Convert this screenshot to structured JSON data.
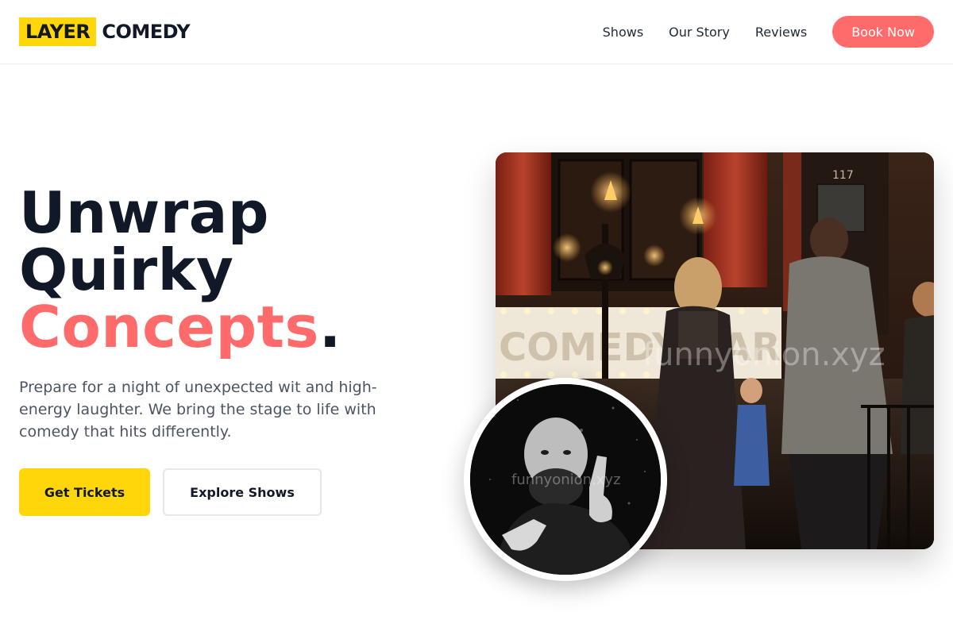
{
  "brand": {
    "highlight": "LAYER",
    "name": "COMEDY",
    "accent_color": "#ffd60a",
    "coral_color": "#ff6b6b"
  },
  "nav": {
    "links": [
      "Shows",
      "Our Story",
      "Reviews"
    ],
    "cta": "Book Now"
  },
  "hero": {
    "headline_line1": "Unwrap",
    "headline_line2": "Quirky",
    "headline_accent": "Concepts",
    "headline_period": ".",
    "subtext": "Prepare for a night of unexpected wit and high-energy laughter. We bring the stage to life with comedy that hits differently.",
    "primary_button": "Get Tickets",
    "secondary_button": "Explore Shows"
  },
  "images": {
    "main_photo": "comedy-club-venue-photo",
    "main_watermark": "funnyonion.xyz",
    "marquee_sign": "COMEDY BAR",
    "room_number": "117",
    "avatar_photo": "comedian-portrait-photo",
    "avatar_watermark": "funnyonion.xyz"
  }
}
